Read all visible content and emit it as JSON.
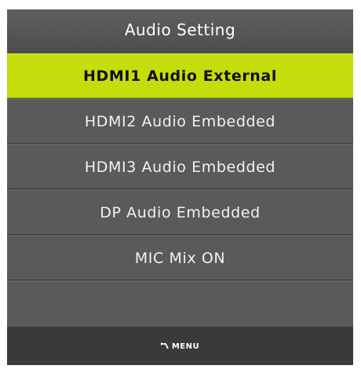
{
  "menu": {
    "title": "Audio Setting",
    "items": [
      {
        "label": "HDMI1 Audio External",
        "selected": true
      },
      {
        "label": "HDMI2 Audio Embedded",
        "selected": false
      },
      {
        "label": "HDMI3 Audio Embedded",
        "selected": false
      },
      {
        "label": "DP Audio Embedded",
        "selected": false
      },
      {
        "label": "MIC Mix ON",
        "selected": false
      },
      {
        "label": "",
        "selected": false
      }
    ],
    "footer": {
      "icon": "return-arrow-icon",
      "label": "MENU"
    },
    "colors": {
      "panel": "#575757",
      "selected": "#c5dd0d",
      "footer": "#3a3a3a"
    }
  }
}
